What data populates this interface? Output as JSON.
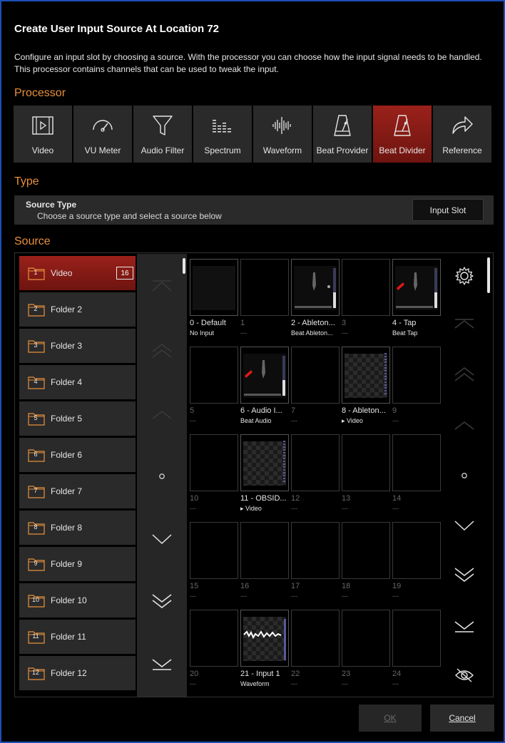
{
  "dialog": {
    "title": "Create User Input Source At Location 72",
    "description": "Configure an input slot by choosing a source. With the processor you can choose how the input signal needs to be handled. This processor contains channels that can be used to tweak the input."
  },
  "sections": {
    "processor": "Processor",
    "type": "Type",
    "source": "Source"
  },
  "processors": [
    {
      "label": "Video",
      "icon": "film-icon"
    },
    {
      "label": "VU Meter",
      "icon": "gauge-icon"
    },
    {
      "label": "Audio Filter",
      "icon": "funnel-icon"
    },
    {
      "label": "Spectrum",
      "icon": "spectrum-icon"
    },
    {
      "label": "Waveform",
      "icon": "waveform-icon"
    },
    {
      "label": "Beat Provider",
      "icon": "metronome-icon"
    },
    {
      "label": "Beat Divider",
      "icon": "metronome-icon",
      "active": true
    },
    {
      "label": "Reference",
      "icon": "forward-arrow-icon"
    }
  ],
  "type_bar": {
    "title": "Source Type",
    "subtitle": "Choose a source type and select a source below",
    "button": "Input Slot"
  },
  "folders": [
    {
      "num": "1",
      "name": "Video",
      "badge": "16",
      "active": true
    },
    {
      "num": "2",
      "name": "Folder 2"
    },
    {
      "num": "3",
      "name": "Folder 3"
    },
    {
      "num": "4",
      "name": "Folder 4"
    },
    {
      "num": "5",
      "name": "Folder 5"
    },
    {
      "num": "6",
      "name": "Folder 6"
    },
    {
      "num": "7",
      "name": "Folder 7"
    },
    {
      "num": "8",
      "name": "Folder 8"
    },
    {
      "num": "9",
      "name": "Folder 9"
    },
    {
      "num": "10",
      "name": "Folder 10"
    },
    {
      "num": "11",
      "name": "Folder 11"
    },
    {
      "num": "12",
      "name": "Folder 12"
    }
  ],
  "slots": [
    {
      "name": "0 - Default",
      "sub": "No Input",
      "filled": true,
      "preview": "dark"
    },
    {
      "name": "1",
      "sub": "---"
    },
    {
      "name": "2 - Ableton...",
      "sub": "Beat  Ableton...",
      "filled": true,
      "preview": "beat"
    },
    {
      "name": "3",
      "sub": "---"
    },
    {
      "name": "4 - Tap",
      "sub": "Beat Tap",
      "filled": true,
      "preview": "beat-red"
    },
    {
      "name": "5",
      "sub": "---"
    },
    {
      "name": "6 - Audio I...",
      "sub": "Beat Audio",
      "filled": true,
      "preview": "beat-red"
    },
    {
      "name": "7",
      "sub": "---"
    },
    {
      "name": "8 - Ableton...",
      "sub": "▸ Video",
      "filled": true,
      "preview": "checker"
    },
    {
      "name": "9",
      "sub": "---"
    },
    {
      "name": "10",
      "sub": "---"
    },
    {
      "name": "11 - OBSID...",
      "sub": "▸ Video",
      "filled": true,
      "preview": "checker"
    },
    {
      "name": "12",
      "sub": "---"
    },
    {
      "name": "13",
      "sub": "---"
    },
    {
      "name": "14",
      "sub": "---"
    },
    {
      "name": "15",
      "sub": "---"
    },
    {
      "name": "16",
      "sub": "---"
    },
    {
      "name": "17",
      "sub": "---"
    },
    {
      "name": "18",
      "sub": "---"
    },
    {
      "name": "19",
      "sub": "---"
    },
    {
      "name": "20",
      "sub": "---"
    },
    {
      "name": "21 - Input 1",
      "sub": "Waveform",
      "filled": true,
      "preview": "waveform"
    },
    {
      "name": "22",
      "sub": "---"
    },
    {
      "name": "23",
      "sub": "---"
    },
    {
      "name": "24",
      "sub": "---"
    }
  ],
  "footer": {
    "ok": "OK",
    "cancel": "Cancel"
  },
  "colors": {
    "accent": "#e8903c",
    "active": "#8e1b16",
    "border": "#1d4fb8",
    "panel": "#2a2a2a"
  }
}
